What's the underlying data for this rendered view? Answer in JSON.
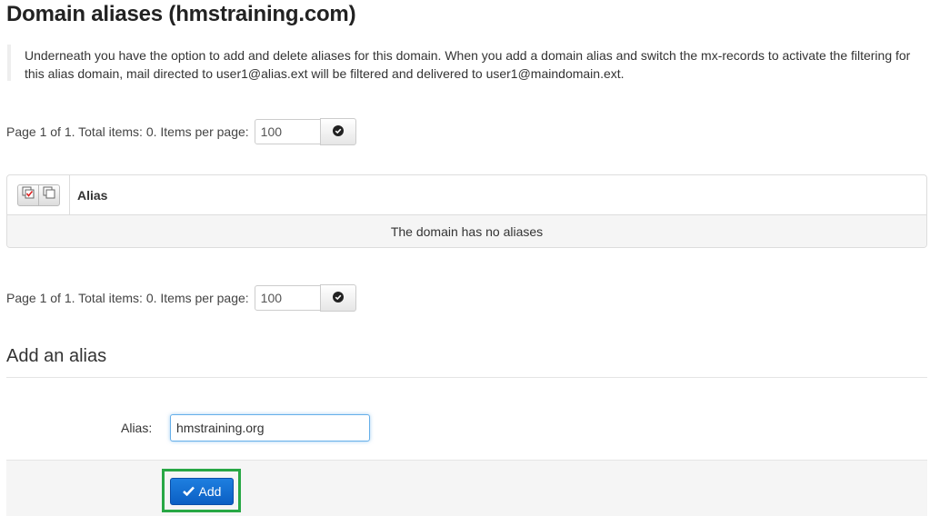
{
  "page": {
    "title": "Domain aliases (hmstraining.com)",
    "intro": "Underneath you have the option to add and delete aliases for this domain. When you add a domain alias and switch the mx-records to activate the filtering for this alias domain, mail directed to user1@alias.ext will be filtered and delivered to user1@maindomain.ext."
  },
  "pager_top": {
    "label": "Page 1 of 1. Total items: 0. Items per page:",
    "per_page": "100",
    "apply_icon": "check-circle-icon"
  },
  "table": {
    "columns": [
      "Alias"
    ],
    "select_all_icon": "check-all-icon",
    "select_none_icon": "uncheck-all-icon",
    "empty_message": "The domain has no aliases"
  },
  "pager_bottom": {
    "label": "Page 1 of 1. Total items: 0. Items per page:",
    "per_page": "100",
    "apply_icon": "check-circle-icon"
  },
  "add_section": {
    "title": "Add an alias",
    "field_label": "Alias:",
    "field_value": "hmstraining.org",
    "button_label": "Add",
    "button_icon": "checkmark-icon",
    "highlight_color": "#28a745",
    "accent_color": "#0b5fc4"
  }
}
